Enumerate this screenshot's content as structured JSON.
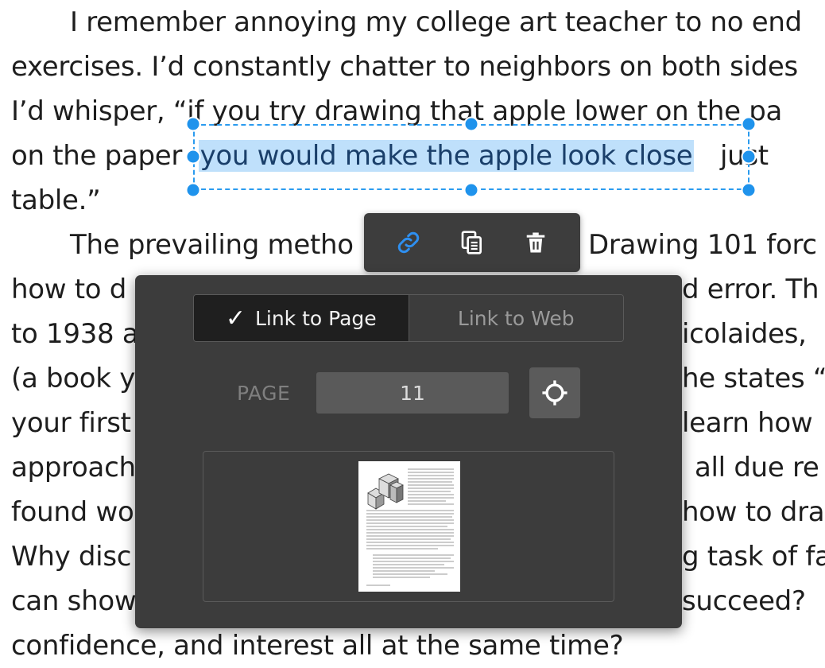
{
  "document": {
    "lines": [
      "I remember annoying my college art teacher to no end",
      "exercises. I’d constantly chatter to neighbors on both sides",
      "I’d whisper, “if you try drawing that apple lower on the pa",
      "on the paper",
      "table.”",
      "The prevailing metho",
      "how to d",
      "to 1938 a",
      "(a book y",
      "your first",
      "approach",
      "found wo",
      "Why disc",
      "can show",
      "confidence, and interest all at the same time?"
    ],
    "highlight": "you would make the apple look close",
    "line4_tail": "just",
    "right_fragments": [
      "Drawing 101 forc",
      "d error. Th",
      "icolaides,",
      "he states “",
      "learn how",
      "all due re",
      "how to dra",
      "g task of fa",
      "succeed?"
    ]
  },
  "toolbar": {
    "link_icon": "link-icon",
    "copy_icon": "copy-icon",
    "delete_icon": "trash-icon",
    "active_color": "#2e8ff0"
  },
  "link_panel": {
    "tab_page_label": "Link to Page",
    "tab_web_label": "Link to Web",
    "active_tab": "Link to Page",
    "page_label": "PAGE",
    "page_value": "11",
    "target_icon": "crosshair-icon",
    "preview_icon": "page-thumbnail"
  },
  "colors": {
    "selection": "#2a9bef",
    "highlight": "#bfe0fb",
    "panel_bg": "#3c3c3c"
  }
}
